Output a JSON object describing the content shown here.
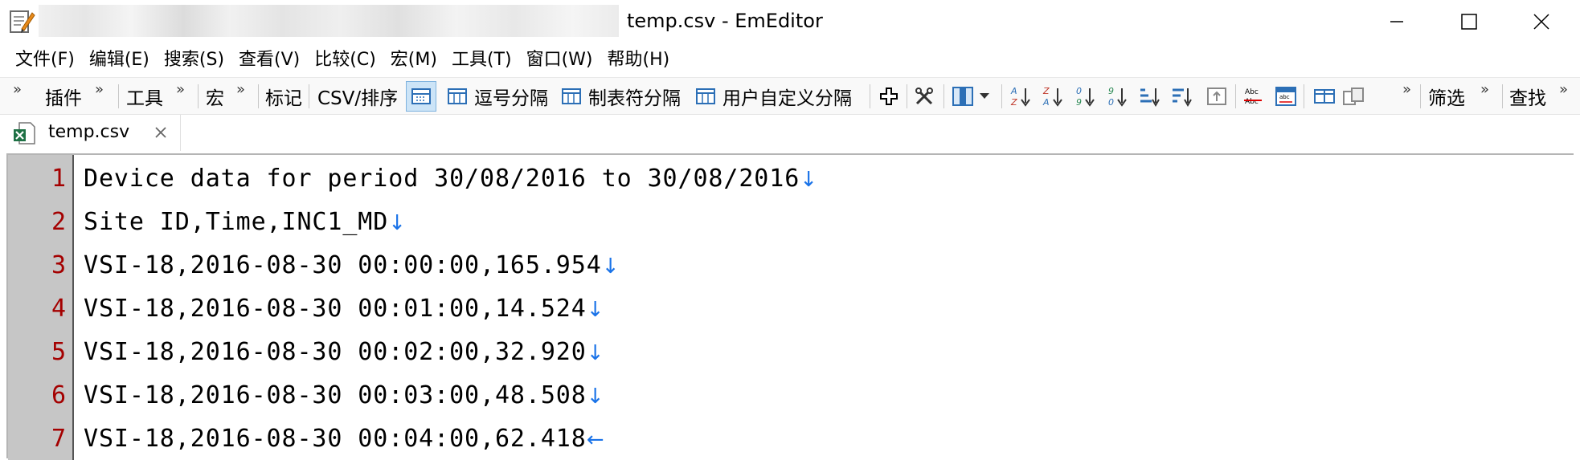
{
  "window": {
    "title": "temp.csv - EmEditor",
    "controls": [
      "minimize",
      "maximize",
      "close"
    ]
  },
  "menu": [
    "文件(F)",
    "编辑(E)",
    "搜索(S)",
    "查看(V)",
    "比较(C)",
    "宏(M)",
    "工具(T)",
    "窗口(W)",
    "帮助(H)"
  ],
  "toolbar": {
    "plugins": "插件",
    "tools": "工具",
    "macro": "宏",
    "mark": "标记",
    "csv_sort": "CSV/排序",
    "comma_sep": "逗号分隔",
    "tab_sep": "制表符分隔",
    "custom_sep": "用户自定义分隔",
    "filter": "筛选",
    "find": "查找",
    "icons": [
      "plus-icon",
      "tools-icon",
      "column-view-icon",
      "sort-az-icon",
      "sort-za-icon",
      "sort-09-icon",
      "sort-90-icon",
      "sort-asc-icon",
      "sort-desc-icon",
      "reflow-icon",
      "spell-check-icon",
      "ruler-icon",
      "split-window-icon",
      "compare-icon"
    ]
  },
  "tab": {
    "label": "temp.csv"
  },
  "editor": {
    "lines": [
      {
        "no": "1",
        "text": "Device data for period 30/08/2016 to 30/08/2016",
        "eol": "↓"
      },
      {
        "no": "2",
        "text": "Site ID,Time,INC1_MD",
        "eol": "↓"
      },
      {
        "no": "3",
        "text": "VSI-18,2016-08-30 00:00:00,165.954",
        "eol": "↓"
      },
      {
        "no": "4",
        "text": "VSI-18,2016-08-30 00:01:00,14.524",
        "eol": "↓"
      },
      {
        "no": "5",
        "text": "VSI-18,2016-08-30 00:02:00,32.920",
        "eol": "↓"
      },
      {
        "no": "6",
        "text": "VSI-18,2016-08-30 00:03:00,48.508",
        "eol": "↓"
      },
      {
        "no": "7",
        "text": "VSI-18,2016-08-30 00:04:00,62.418",
        "eol": "←"
      }
    ]
  },
  "colors": {
    "line_number": "#a40000",
    "eol_marker": "#1a73e8",
    "gutter": "#c6c6c6"
  }
}
